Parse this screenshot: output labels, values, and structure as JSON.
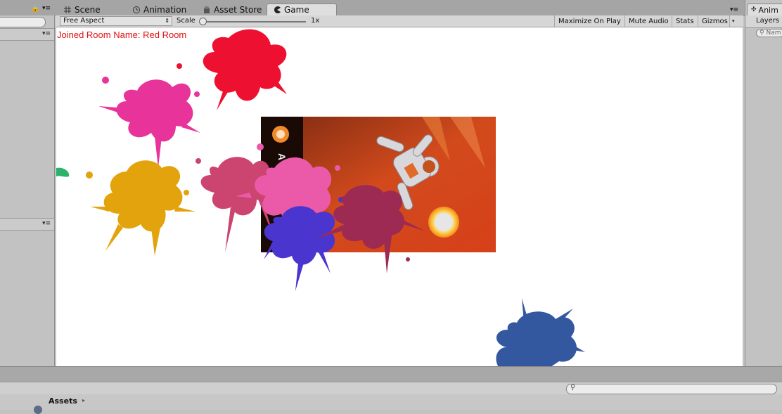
{
  "tabs": [
    {
      "label": "Scene",
      "icon": "grid-icon"
    },
    {
      "label": "Animation",
      "icon": "clock-icon"
    },
    {
      "label": "Asset Store",
      "icon": "bag-icon"
    },
    {
      "label": "Game",
      "icon": "pacman-icon"
    }
  ],
  "right_panel": {
    "tab_label": "Anim",
    "layers_label": "Layers",
    "search_placeholder": "Nam"
  },
  "toolbar": {
    "aspect": "Free Aspect",
    "scale_label": "Scale",
    "scale_value": "1x",
    "maximize": "Maximize On Play",
    "mute": "Mute Audio",
    "stats": "Stats",
    "gizmos": "Gizmos"
  },
  "game": {
    "room_text": "Joined Room Name: Red Room",
    "banner_letter": "A"
  },
  "project": {
    "assets_label": "Assets"
  },
  "colors": {
    "red_splat": "#ee1030",
    "pink_splat": "#e8349a",
    "yellow_splat": "#e2a30c",
    "rose_splat": "#cc4470",
    "hotpink_splat": "#ea5aa8",
    "purple_splat": "#4a35cf",
    "maroon_splat": "#9c2a52",
    "blue_splat": "#34589f",
    "green_splat": "#2bb36b"
  }
}
